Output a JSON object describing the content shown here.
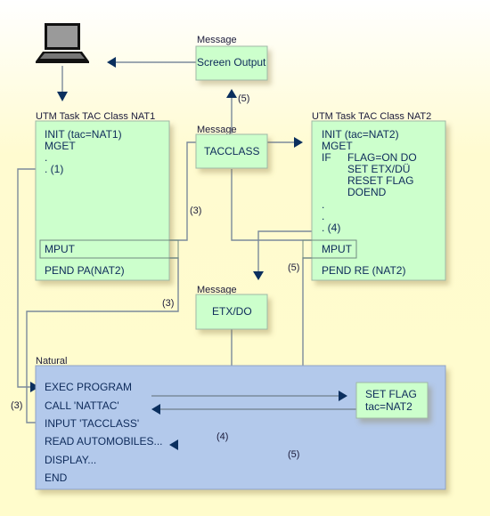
{
  "colors": {
    "message_box": "#ccffcc",
    "natural_box": "#b3c9eb",
    "arrow": "#0b2f5e",
    "line": "#7b8a9b",
    "text": "#0d2a5a"
  },
  "terminal": {
    "icon": "laptop-icon"
  },
  "screen_output": {
    "caption": "Message",
    "text": "Screen Output"
  },
  "tacclass": {
    "caption": "Message",
    "text": "TACCLASS"
  },
  "etxdo": {
    "caption": "Message",
    "text": "ETX/DO"
  },
  "nat1": {
    "title": "UTM Task TAC Class NAT1",
    "lines": [
      "INIT (tac=NAT1)",
      "MGET",
      ".",
      ". (1)"
    ],
    "mput": "MPUT",
    "pend": "PEND PA(NAT2)"
  },
  "nat2": {
    "title": "UTM Task TAC Class NAT2",
    "lines": [
      "INIT (tac=NAT2)",
      "MGET",
      "IF",
      "FLAG=ON DO",
      "SET ETX/DÜ",
      "RESET FLAG",
      "DOEND",
      ".",
      ".",
      ". (4)"
    ],
    "mput": "MPUT",
    "pend": "PEND RE (NAT2)"
  },
  "natural": {
    "title": "Natural",
    "lines": [
      "EXEC PROGRAM",
      "CALL 'NATTAC'",
      "INPUT 'TACCLASS'",
      "READ AUTOMOBILES...",
      "DISPLAY...",
      "END"
    ]
  },
  "setflag": {
    "lines": [
      "SET FLAG",
      "tac=NAT2"
    ]
  },
  "step_labels": {
    "s3a": "(3)",
    "s3b": "(3)",
    "s3c": "(3)",
    "s4": "(4)",
    "s5a": "(5)",
    "s5b": "(5)",
    "s5c": "(5)"
  }
}
